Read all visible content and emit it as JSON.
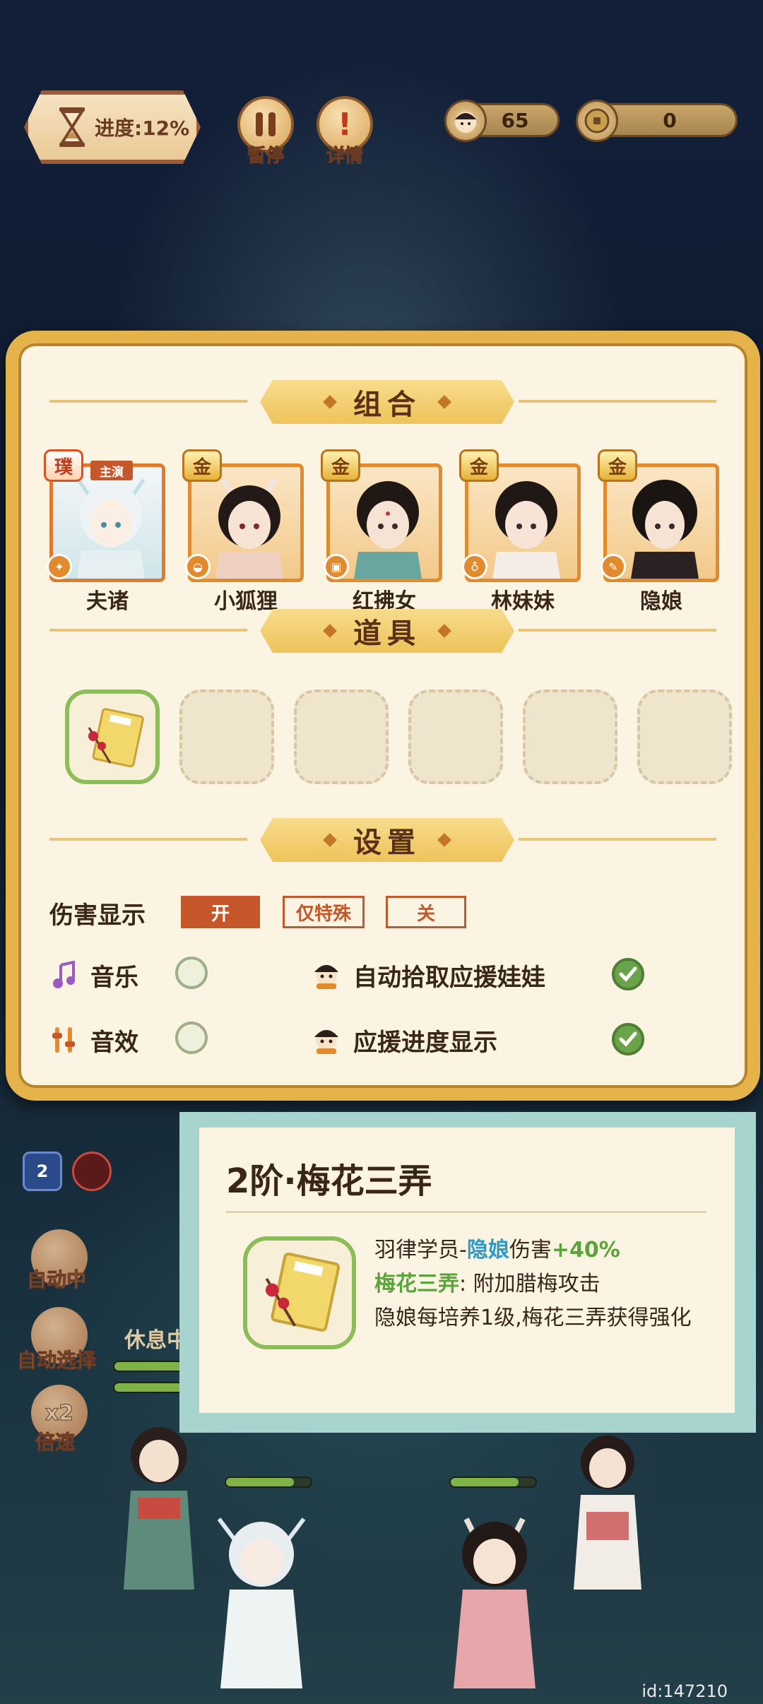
{
  "hud": {
    "progress_label": "进度:12%",
    "pause_label": "暂停",
    "details_label": "详情",
    "coins_a": "65",
    "coins_b": "0"
  },
  "panel": {
    "combo_title": "组合",
    "items_title": "道具",
    "settings_title": "设置",
    "heroes": [
      {
        "badge": "璞",
        "name": "夫诸",
        "lead": "主演",
        "icon": "sword-icon"
      },
      {
        "badge": "金",
        "name": "小狐狸",
        "icon": "bowl-icon"
      },
      {
        "badge": "金",
        "name": "红拂女",
        "icon": "lantern-icon"
      },
      {
        "badge": "金",
        "name": "林妹妹",
        "icon": "gourd-icon"
      },
      {
        "badge": "金",
        "name": "隐娘",
        "icon": "brush-icon"
      }
    ],
    "damage_display": {
      "label": "伤害显示",
      "options": [
        "开",
        "仅特殊",
        "关"
      ],
      "selected": "开"
    },
    "music_label": "音乐",
    "music_on": false,
    "sfx_label": "音效",
    "sfx_on": false,
    "auto_pickup_label": "自动拾取应援娃娃",
    "auto_pickup_on": true,
    "support_progress_label": "应援进度显示",
    "support_progress_on": true
  },
  "tooltip": {
    "title": "2阶·梅花三弄",
    "line1_a": "羽律学员-",
    "line1_hero": "隐娘",
    "line1_b": "伤害",
    "line1_bonus": "+40%",
    "line2_skill": "梅花三弄",
    "line2_rest": ": 附加腊梅攻击",
    "line3": "隐娘每培养1级,梅花三弄获得强化"
  },
  "side": {
    "auto_label": "自动中",
    "auto_select_label": "自动选择",
    "speed_label": "倍速",
    "speed_value": "x2",
    "rest_label": "休息中",
    "skill_count": "2"
  },
  "id_label": "id:147210",
  "colors": {
    "panel_border": "#e6b24a",
    "accent_red": "#c5572a",
    "check_green": "#6aa34a",
    "tooltip_frame": "#a8d4cf"
  }
}
